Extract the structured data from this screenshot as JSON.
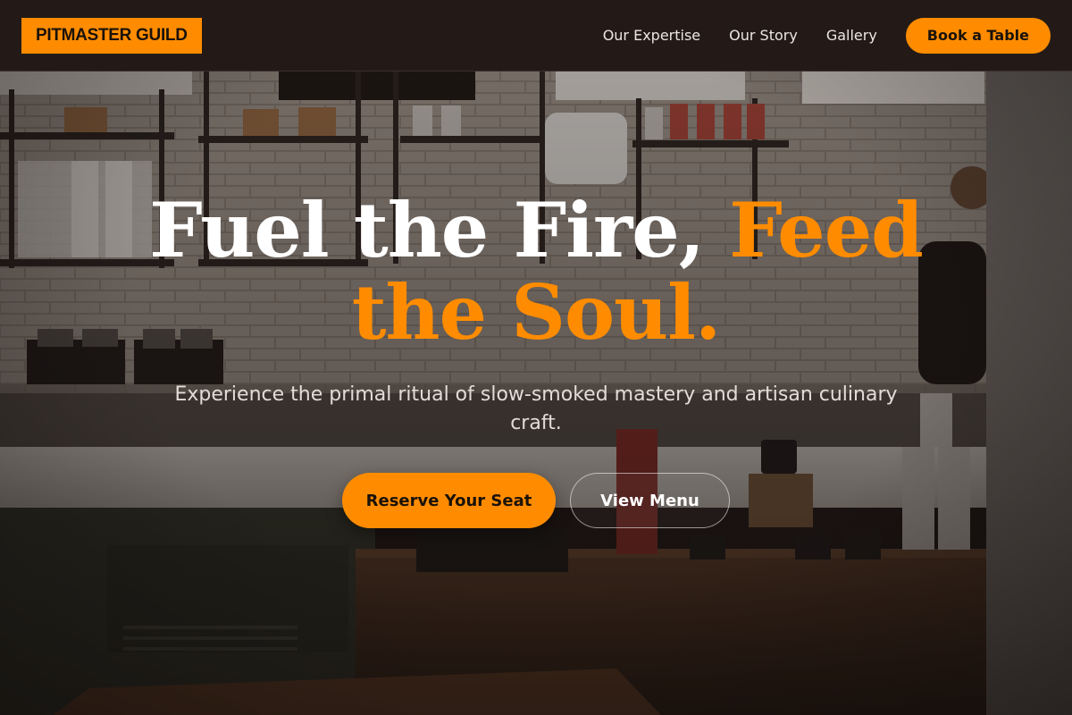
{
  "brand": {
    "name": "PITMASTER GUILD",
    "accent_color": "#ff8c00",
    "header_bg": "#231a18"
  },
  "nav": {
    "links": [
      "Our Expertise",
      "Our Story",
      "Gallery"
    ],
    "cta_label": "Book a Table"
  },
  "hero": {
    "headline_white": "Fuel the Fire, ",
    "headline_accent": "Feed the Soul.",
    "subtitle": "Experience the primal ritual of slow-smoked mastery and artisan culinary craft.",
    "primary_button": "Reserve Your Seat",
    "secondary_button": "View Menu",
    "background_image": "cafe-interior-photo"
  }
}
